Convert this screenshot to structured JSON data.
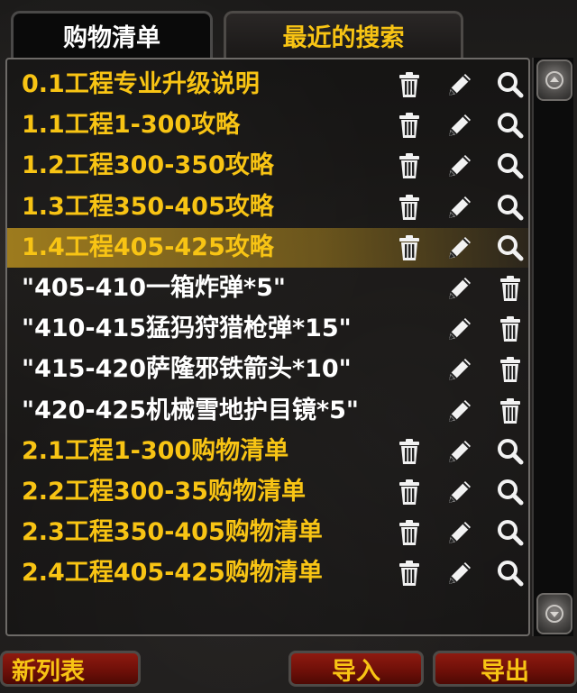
{
  "tabs": [
    {
      "label": "购物清单",
      "active": true
    },
    {
      "label": "最近的搜索",
      "active": false
    }
  ],
  "rows": [
    {
      "label": "0.1工程专业升级说明",
      "style": "gold",
      "icons": [
        "trash-icon",
        "pencil-icon",
        "magnifier-icon"
      ]
    },
    {
      "label": "1.1工程1-300攻略",
      "style": "gold",
      "icons": [
        "trash-icon",
        "pencil-icon",
        "magnifier-icon"
      ]
    },
    {
      "label": "1.2工程300-350攻略",
      "style": "gold",
      "icons": [
        "trash-icon",
        "pencil-icon",
        "magnifier-icon"
      ]
    },
    {
      "label": "1.3工程350-405攻略",
      "style": "gold",
      "icons": [
        "trash-icon",
        "pencil-icon",
        "magnifier-icon"
      ]
    },
    {
      "label": "1.4工程405-425攻略",
      "style": "gold",
      "selected": true,
      "icons": [
        "trash-icon",
        "pencil-icon",
        "magnifier-icon"
      ]
    },
    {
      "label": "\"405-410一箱炸弹*5\"",
      "style": "white",
      "icons": [
        "pencil-icon",
        "trash-icon"
      ]
    },
    {
      "label": "\"410-415猛犸狩猎枪弹*15\"",
      "style": "white",
      "icons": [
        "pencil-icon",
        "trash-icon"
      ]
    },
    {
      "label": "\"415-420萨隆邪铁箭头*10\"",
      "style": "white",
      "icons": [
        "pencil-icon",
        "trash-icon"
      ]
    },
    {
      "label": "\"420-425机械雪地护目镜*5\"",
      "style": "white",
      "icons": [
        "pencil-icon",
        "trash-icon"
      ]
    },
    {
      "label": "2.1工程1-300购物清单",
      "style": "gold",
      "icons": [
        "trash-icon",
        "pencil-icon",
        "magnifier-icon"
      ]
    },
    {
      "label": "2.2工程300-35购物清单",
      "style": "gold",
      "icons": [
        "trash-icon",
        "pencil-icon",
        "magnifier-icon"
      ]
    },
    {
      "label": "2.3工程350-405购物清单",
      "style": "gold",
      "icons": [
        "trash-icon",
        "pencil-icon",
        "magnifier-icon"
      ]
    },
    {
      "label": "2.4工程405-425购物清单",
      "style": "gold",
      "icons": [
        "trash-icon",
        "pencil-icon",
        "magnifier-icon"
      ]
    }
  ],
  "buttons": {
    "new_list": "新列表",
    "import": "导入",
    "export": "导出"
  },
  "colors": {
    "accent_gold": "#f8c414",
    "button_red": "#8e1a10",
    "selected_row": "#b48c1e"
  }
}
